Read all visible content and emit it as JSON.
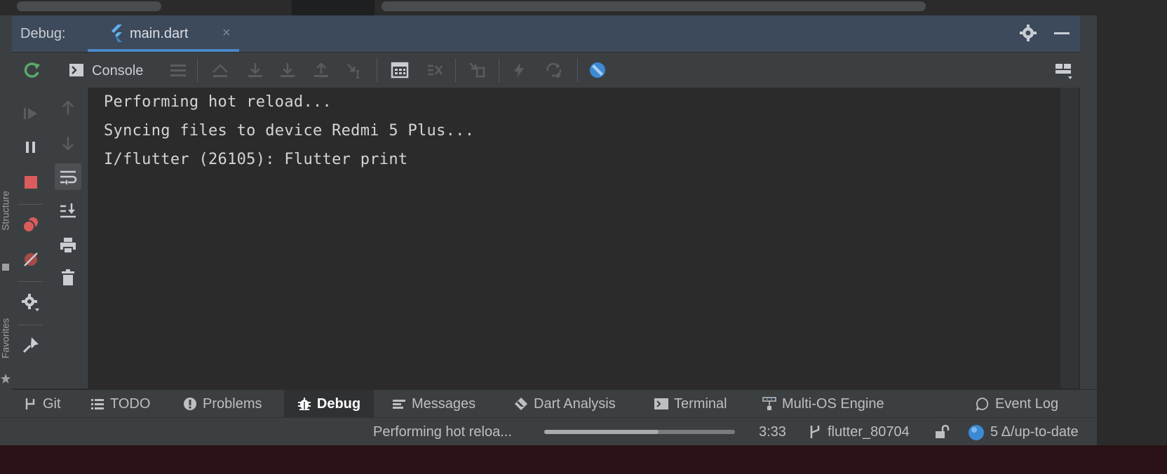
{
  "header": {
    "panel_label": "Debug:",
    "tab": {
      "label": "main.dart",
      "close_glyph": "×",
      "icon": "flutter-icon"
    },
    "actions": [
      "settings-gear-icon",
      "minimize-icon"
    ]
  },
  "toolbar": {
    "console_label": "Console",
    "icons": [
      "console-icon",
      "menu-lines-icon",
      "show-execution-point-icon",
      "step-over-icon",
      "step-into-icon",
      "step-out-icon",
      "run-to-cursor-icon",
      "evaluate-expression-icon",
      "trace-icon",
      "restore-layout-icon",
      "hot-reload-icon",
      "hot-restart-icon",
      "dart-devtools-icon",
      "layout-options-icon"
    ]
  },
  "left_actions": [
    "rerun-icon",
    "resume-icon",
    "pause-icon",
    "stop-icon",
    "view-breakpoints-icon",
    "mute-breakpoints-icon",
    "settings-icon",
    "pin-icon"
  ],
  "console_actions": [
    "scroll-up-icon",
    "scroll-down-icon",
    "soft-wrap-icon",
    "scroll-to-end-icon",
    "print-icon",
    "clear-icon"
  ],
  "side_labels": {
    "structure": "Structure",
    "favorites": "Favorites"
  },
  "console": {
    "lines": [
      "Performing hot reload...",
      "Syncing files to device Redmi 5 Plus...",
      "I/flutter (26105): Flutter print"
    ]
  },
  "tool_windows": [
    {
      "label": "Git",
      "icon": "git-icon"
    },
    {
      "label": "TODO",
      "icon": "todo-icon"
    },
    {
      "label": "Problems",
      "icon": "problems-icon"
    },
    {
      "label": "Debug",
      "icon": "bug-icon",
      "active": true
    },
    {
      "label": "Messages",
      "icon": "messages-icon"
    },
    {
      "label": "Dart Analysis",
      "icon": "dart-icon"
    },
    {
      "label": "Terminal",
      "icon": "terminal-icon"
    },
    {
      "label": "Multi-OS Engine",
      "icon": "multi-os-icon"
    },
    {
      "label": "Event Log",
      "icon": "event-log-icon"
    }
  ],
  "status": {
    "task_text": "Performing hot reloa...",
    "progress": 0.6,
    "cursor_pos": "3:33",
    "branch": "flutter_80704",
    "vcs_status": "5 Δ/up-to-date"
  },
  "colors": {
    "header_bg": "#3d4a5c",
    "tab_underline": "#4a88c7",
    "panel_bg": "#3c3f41",
    "console_bg": "#2b2b2b",
    "rerun_green": "#59a869",
    "stop_red": "#db5c5c",
    "dart_blue": "#3c8ad4"
  }
}
